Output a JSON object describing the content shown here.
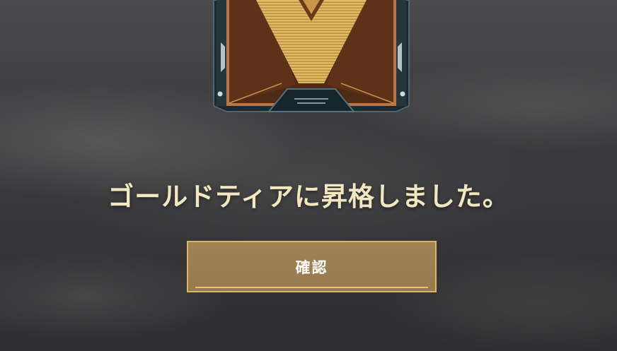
{
  "rank_emblem": {
    "icon": "gold-tier-emblem-icon",
    "accent_color": "#d9b766"
  },
  "promotion": {
    "message": "ゴールドティアに昇格しました。"
  },
  "confirm_button": {
    "label": "確認"
  },
  "colors": {
    "text": "#f2e7c0",
    "button_fill": "#9a7d50",
    "button_border": "#d9b766"
  }
}
